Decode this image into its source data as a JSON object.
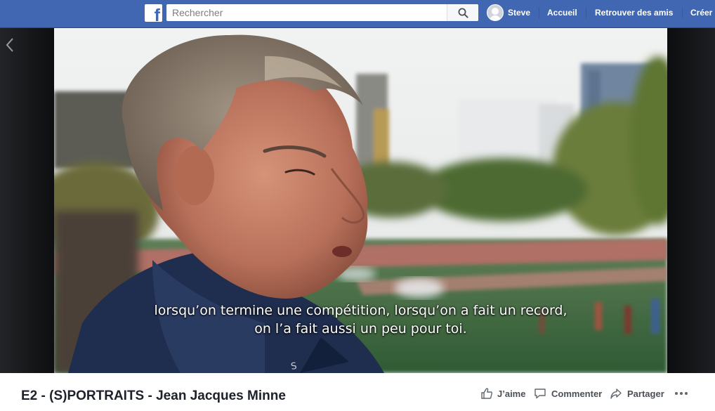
{
  "header": {
    "search": {
      "placeholder": "Rechercher"
    },
    "user": {
      "name": "Steve"
    },
    "nav": [
      {
        "label": "Accueil"
      },
      {
        "label": "Retrouver des amis"
      },
      {
        "label": "Créer"
      }
    ]
  },
  "video": {
    "subtitle_lines": [
      "lorsqu’on termine une compétition, lorsqu’on a fait un record,",
      "on l’a fait aussi un peu pour toi."
    ]
  },
  "footer": {
    "title": "E2 - (S)PORTRAITS - Jean Jacques Minne",
    "actions": {
      "like": "J’aime",
      "comment": "Commenter",
      "share": "Partager"
    }
  },
  "colors": {
    "brand": "#4267b2",
    "nav_text": "#ffffff",
    "title_text": "#1d2129",
    "action_text": "#4b4f56"
  },
  "icons": [
    "facebook-logo",
    "search-icon",
    "avatar",
    "chevron-left-icon",
    "thumbs-up-icon",
    "comment-icon",
    "share-icon",
    "more-icon"
  ]
}
